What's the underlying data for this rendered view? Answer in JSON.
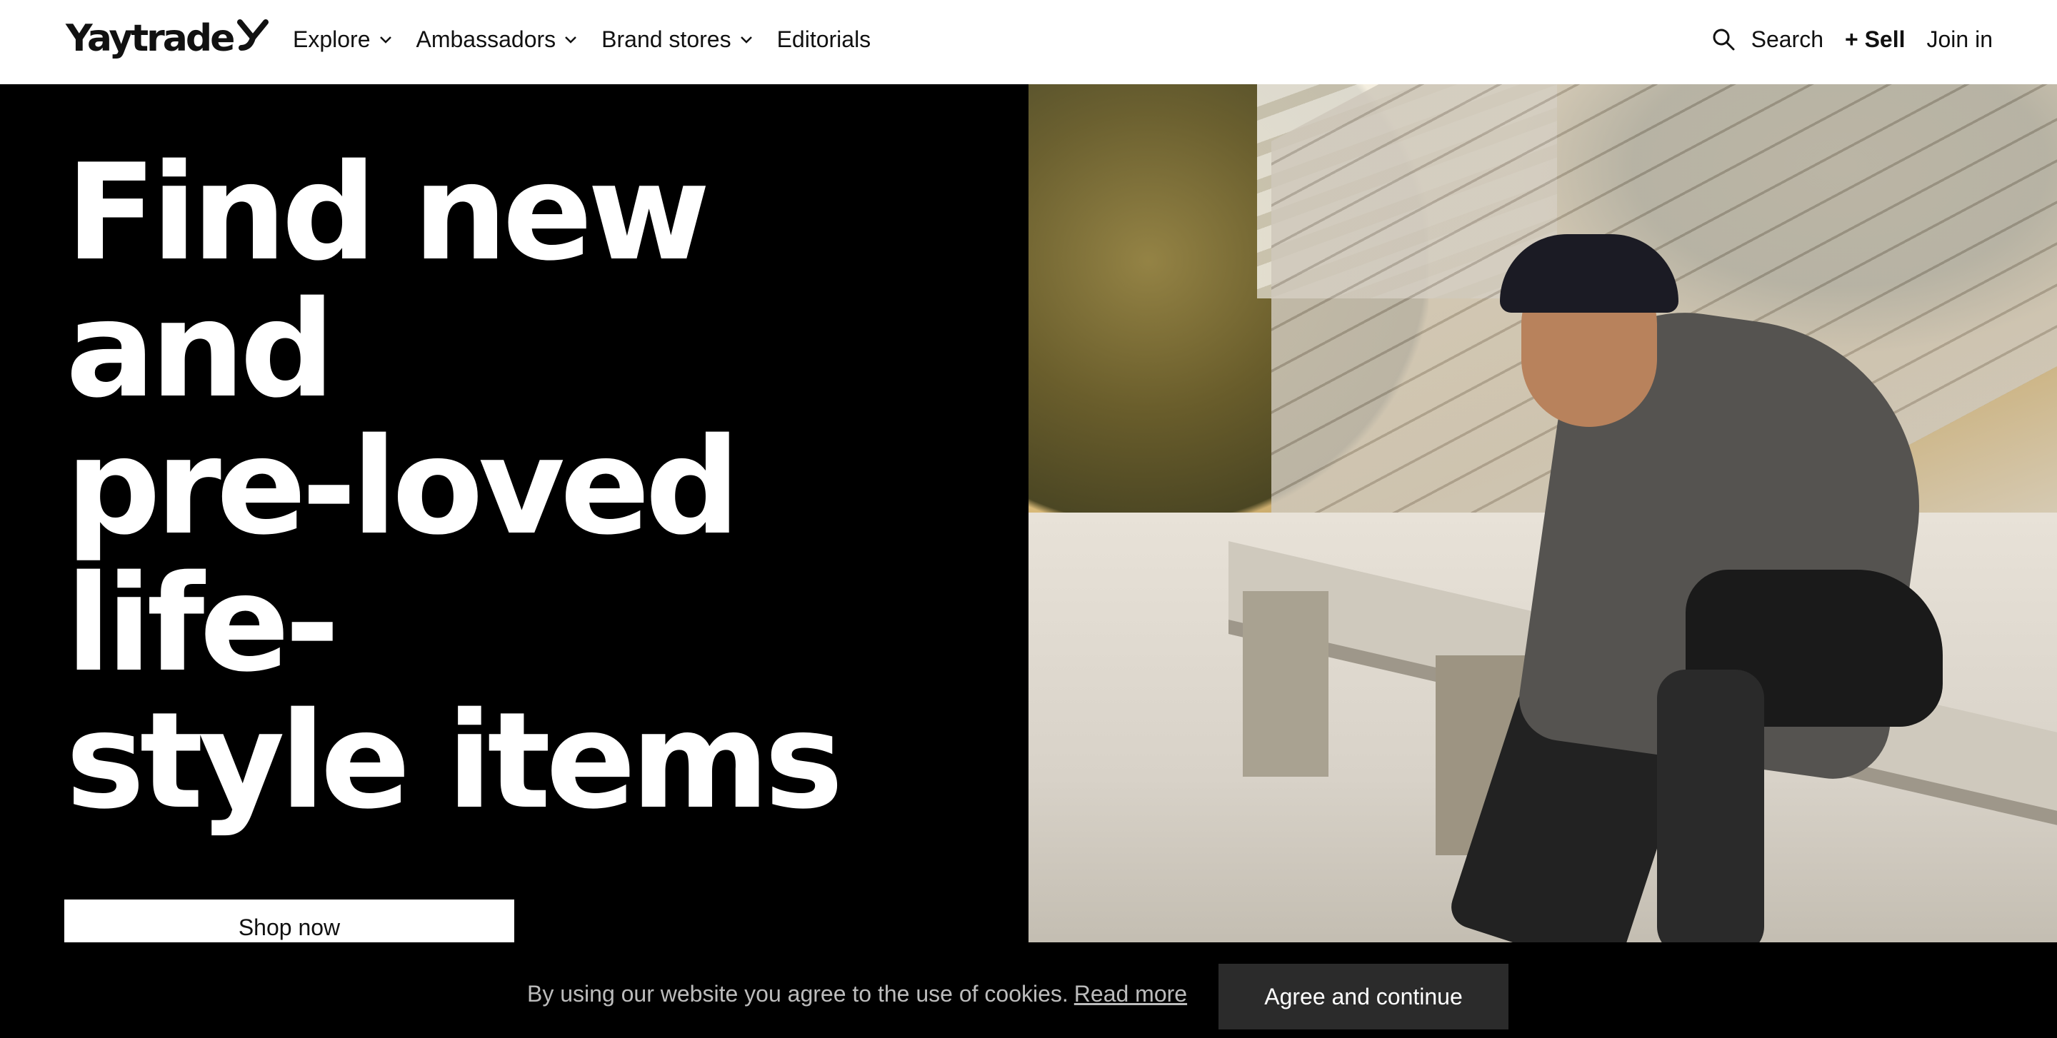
{
  "header": {
    "logo_text": "Yaytrade",
    "nav": [
      {
        "label": "Explore",
        "has_dropdown": true
      },
      {
        "label": "Ambassadors",
        "has_dropdown": true
      },
      {
        "label": "Brand stores",
        "has_dropdown": true
      },
      {
        "label": "Editorials",
        "has_dropdown": false
      }
    ],
    "search_label": "Search",
    "sell_label": "+ Sell",
    "join_label": "Join in"
  },
  "hero": {
    "title_lines": [
      "Find new and",
      "pre-loved life-",
      "style items"
    ],
    "cta_label": "Shop now",
    "image_icon": "photo-skateboarder-sitting-on-bench"
  },
  "cookie": {
    "text": "By using our website you agree to the use of cookies.",
    "link_label": "Read more",
    "button_label": "Agree and continue"
  },
  "colors": {
    "header_bg": "#ffffff",
    "hero_bg": "#000000",
    "cta_bg": "#ffffff",
    "cookie_button_bg": "#2b2b2b"
  }
}
